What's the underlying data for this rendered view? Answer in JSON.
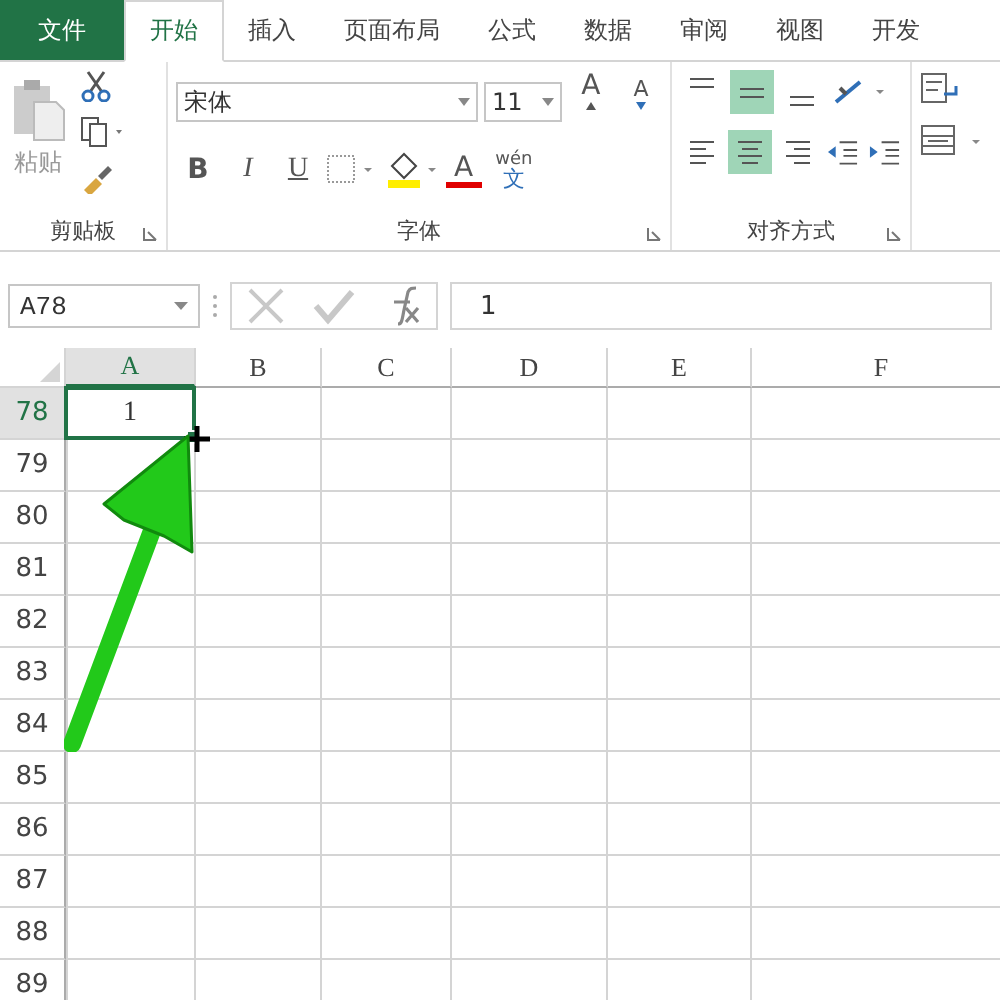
{
  "tabs": [
    {
      "label": "文件",
      "kind": "file",
      "selected": false
    },
    {
      "label": "开始",
      "kind": "tab",
      "selected": true
    },
    {
      "label": "插入",
      "kind": "tab",
      "selected": false
    },
    {
      "label": "页面布局",
      "kind": "tab",
      "selected": false
    },
    {
      "label": "公式",
      "kind": "tab",
      "selected": false
    },
    {
      "label": "数据",
      "kind": "tab",
      "selected": false
    },
    {
      "label": "审阅",
      "kind": "tab",
      "selected": false
    },
    {
      "label": "视图",
      "kind": "tab",
      "selected": false
    },
    {
      "label": "开发",
      "kind": "tab",
      "selected": false
    }
  ],
  "clipboard": {
    "paste": "粘贴",
    "label": "剪贴板"
  },
  "font": {
    "name": "宋体",
    "size": "11",
    "grow": "A",
    "shrink": "A",
    "styles": [
      "B",
      "I",
      "U"
    ],
    "color_letter": "A",
    "phonetic_top": "wén",
    "phonetic_bottom": "文",
    "label": "字体"
  },
  "alignment": {
    "vertical": [
      {
        "kind": "top",
        "selected": false
      },
      {
        "kind": "middle",
        "selected": true
      },
      {
        "kind": "bottom",
        "selected": false
      }
    ],
    "horizontal": [
      {
        "kind": "left",
        "selected": false
      },
      {
        "kind": "center",
        "selected": true
      },
      {
        "kind": "right",
        "selected": false
      }
    ],
    "label": "对齐方式"
  },
  "name_box": "A78",
  "formula": "1",
  "columns": [
    {
      "label": "A",
      "selected": true
    },
    {
      "label": "B",
      "selected": false
    },
    {
      "label": "C",
      "selected": false
    },
    {
      "label": "D",
      "selected": false
    },
    {
      "label": "E",
      "selected": false
    },
    {
      "label": "F",
      "selected": false
    }
  ],
  "rows": [
    {
      "number": "78",
      "selected": true,
      "cells": [
        "1"
      ]
    },
    {
      "number": "79",
      "selected": false
    },
    {
      "number": "80",
      "selected": false
    },
    {
      "number": "81",
      "selected": false
    },
    {
      "number": "82",
      "selected": false
    },
    {
      "number": "83",
      "selected": false
    },
    {
      "number": "84",
      "selected": false
    },
    {
      "number": "85",
      "selected": false
    },
    {
      "number": "86",
      "selected": false
    },
    {
      "number": "87",
      "selected": false
    },
    {
      "number": "88",
      "selected": false
    },
    {
      "number": "89",
      "selected": false
    }
  ]
}
